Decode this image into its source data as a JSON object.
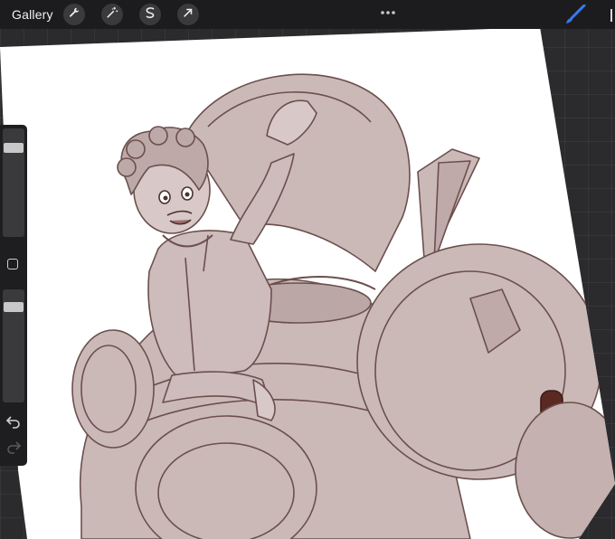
{
  "toolbar": {
    "gallery_label": "Gallery",
    "tools": [
      {
        "name": "wrench-icon"
      },
      {
        "name": "magic-wand-icon"
      },
      {
        "name": "selection-icon"
      },
      {
        "name": "arrow-cursor-icon"
      }
    ],
    "more_icon": "three-dots-icon",
    "brush_icon": "brush-icon"
  },
  "sidebar": {
    "brush_size_level": 0.85,
    "opacity_level": 0.88,
    "modifier_icon": "square-icon",
    "undo_icon": "undo-icon",
    "redo_icon": "redo-icon"
  },
  "colors": {
    "ui_dark": "#1c1c1e",
    "canvas_bg": "#2b2b2d",
    "paper": "#ffffff",
    "sketch_fill": "#cbb9b8",
    "line": "#6b4f4d",
    "accent_blue": "#3a78f2",
    "dark_accent": "#5a2a22"
  }
}
